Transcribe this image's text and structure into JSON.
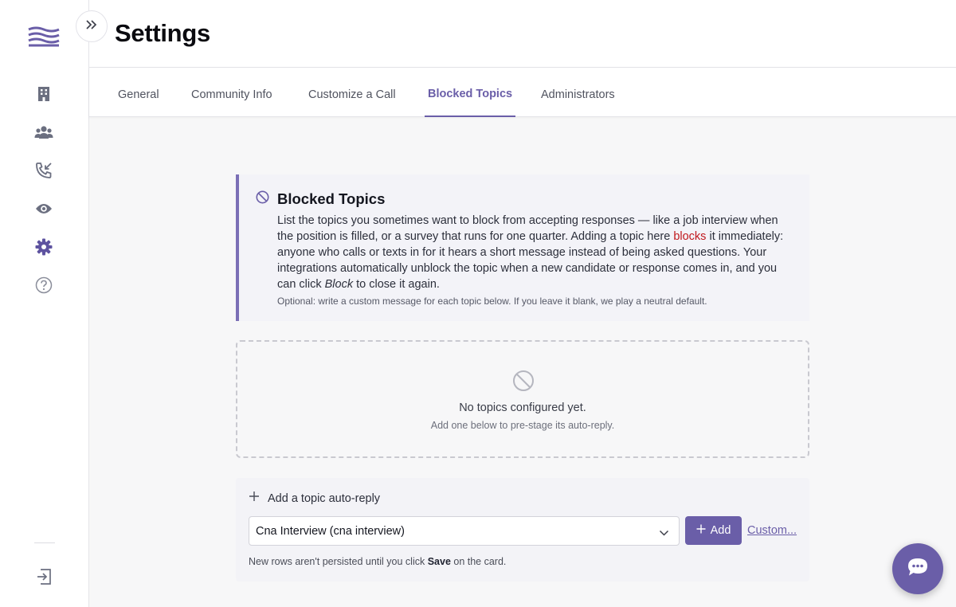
{
  "app": {
    "title": "Settings"
  },
  "colors": {
    "accent": "#6a5ea8",
    "highlight": "#c0181d",
    "sidebar_icon": "#6b6f80"
  },
  "sidebar": {
    "items": [
      {
        "icon": "building-icon"
      },
      {
        "icon": "users-icon"
      },
      {
        "icon": "phone-incoming-icon"
      },
      {
        "icon": "eye-icon"
      },
      {
        "icon": "gear-icon",
        "active": true
      },
      {
        "icon": "help-icon"
      },
      {
        "icon": "logout-icon"
      }
    ]
  },
  "tabs": [
    {
      "label": "General"
    },
    {
      "label": "Community Info"
    },
    {
      "label": "Customize a Call"
    },
    {
      "label": "Blocked Topics",
      "active": true
    },
    {
      "label": "Administrators"
    }
  ],
  "info": {
    "title": "Blocked Topics",
    "body_1": "List the topics you sometimes want to block from accepting responses — like a job interview when the position is filled, or a survey that runs for one quarter. Adding a topic here ",
    "body_highlight": "blocks",
    "body_2": " it immediately: anyone who calls or texts in for it hears a short message instead of being asked questions. Your integrations automatically unblock the topic when a new candidate or response comes in, and you can click ",
    "body_italic": "Block",
    "body_3": " to close it again.",
    "note": "Optional: write a custom message for each topic below. If you leave it blank, we play a neutral default."
  },
  "empty": {
    "title": "No topics configured yet.",
    "subtitle": "Add one below to pre-stage its auto-reply."
  },
  "add_topic": {
    "header": "Add a topic auto-reply",
    "selected": "Cna Interview (cna interview)",
    "add_label": "Add",
    "custom_label": "Custom...",
    "note_1": "New rows aren't persisted until you click ",
    "note_bold": "Save",
    "note_2": " on the card."
  }
}
